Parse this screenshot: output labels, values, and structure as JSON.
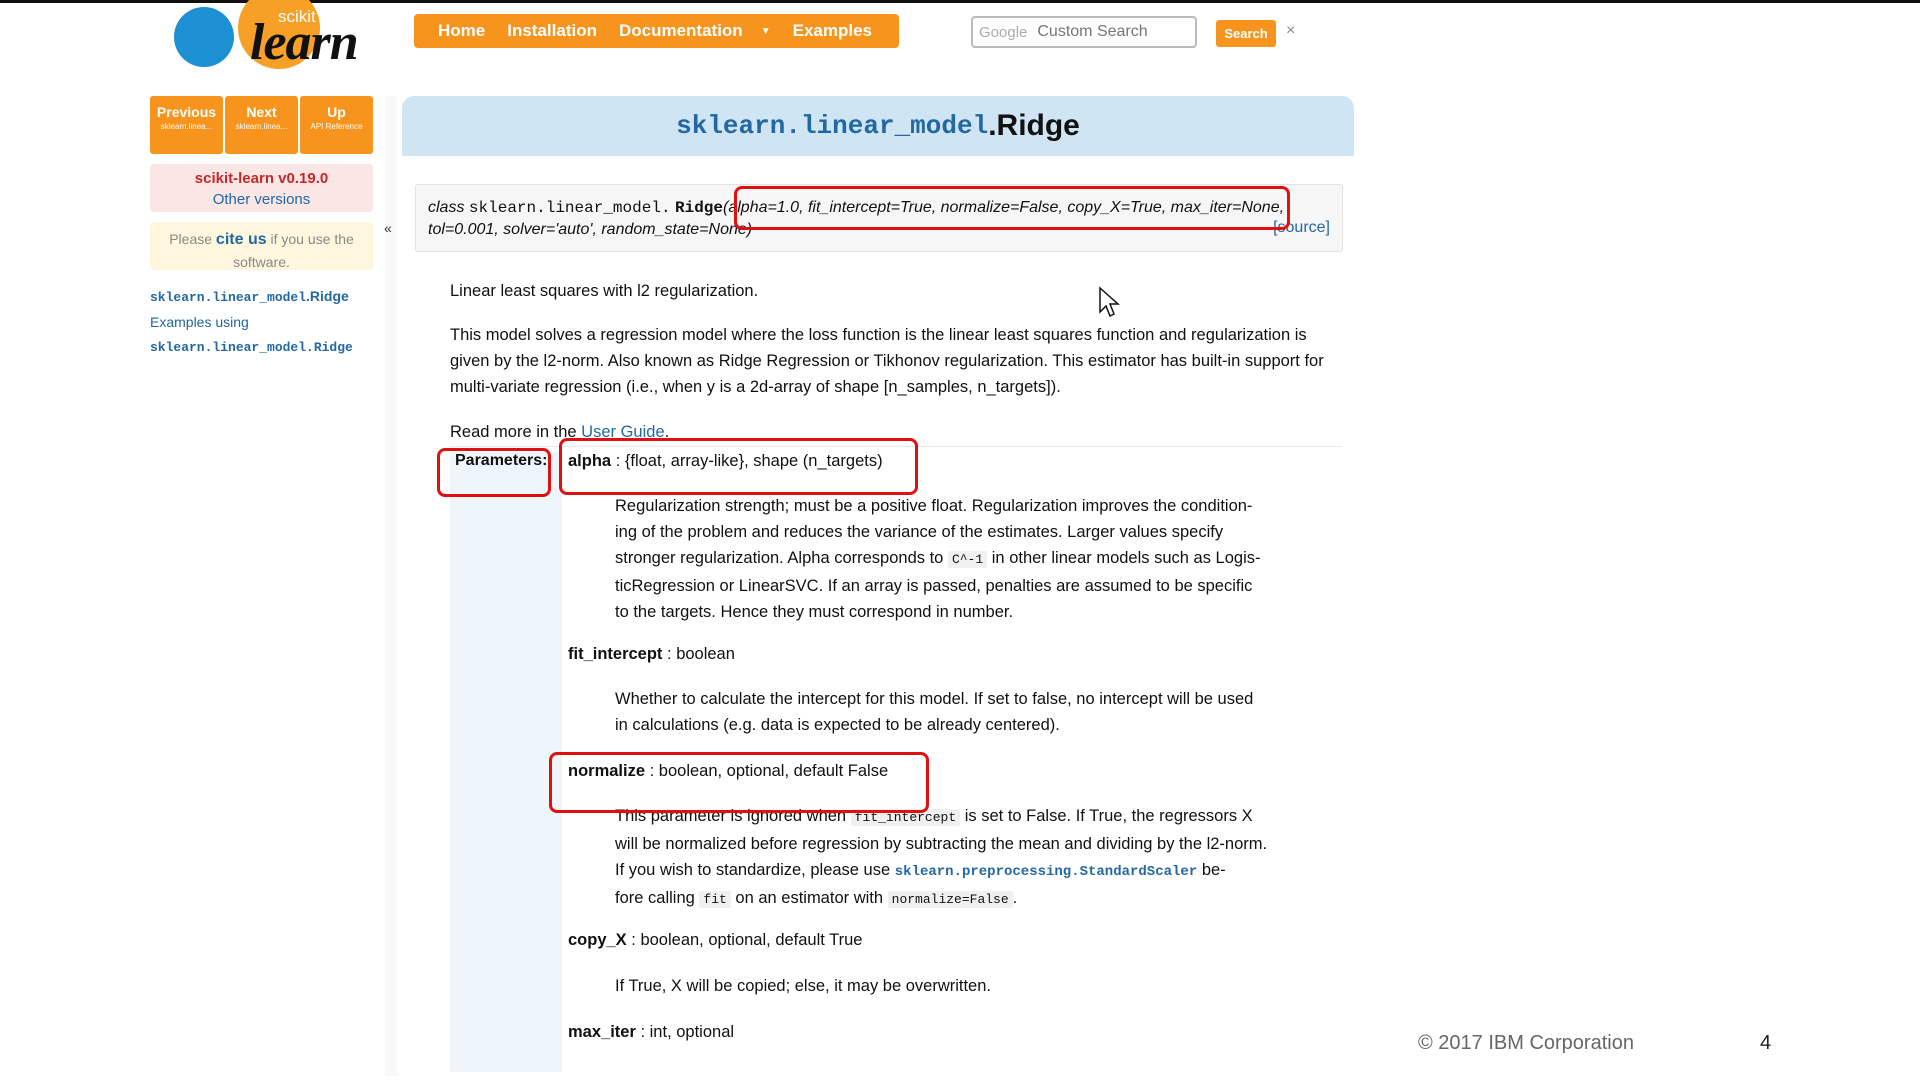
{
  "logo": {
    "scikit": "scikit",
    "learn": "learn"
  },
  "nav": {
    "home": "Home",
    "installation": "Installation",
    "documentation": "Documentation",
    "examples": "Examples"
  },
  "search": {
    "google": "Google",
    "placeholder": "Custom Search",
    "button": "Search",
    "close": "×"
  },
  "sidebar": {
    "previous": {
      "label": "Previous",
      "sub": "sklearn.linea..."
    },
    "next": {
      "label": "Next",
      "sub": "sklearn.linea..."
    },
    "up": {
      "label": "Up",
      "sub": "API Reference"
    },
    "version": "scikit-learn v0.19.0",
    "other_versions": "Other versions",
    "cite_pre": "Please",
    "cite_link": "cite us",
    "cite_post": "if you use the software.",
    "link_module": "sklearn.linear_model",
    "link_class": ".Ridge",
    "examples_using": "Examples using",
    "examples_code": "sklearn.linear_model.Ridge",
    "collapse": "«"
  },
  "title": {
    "module": "sklearn.linear_model",
    "cls": ".Ridge"
  },
  "signature": {
    "prefix": "class",
    "module": "sklearn.linear_model.",
    "cls": "Ridge",
    "args_line1": "(alpha=1.0, fit_intercept=True, normalize=False, copy_X=True, max_iter=None,",
    "args_line2": "tol=0.001, solver='auto', random_state=None)",
    "source": "[source]"
  },
  "intro": "Linear least squares with l2 regularization.",
  "description": "This model solves a regression model where the loss function is the linear least squares function and regularization is given by the l2-norm. Also known as Ridge Regression or Tikhonov regularization. This estimator has built-in support for multi-variate regression (i.e., when y is a 2d-array of shape [n_samples, n_targets]).",
  "read_more": {
    "pre": "Read more in the",
    "link": "User Guide",
    "post": "."
  },
  "params": {
    "label": "Parameters:",
    "alpha": {
      "name": "alpha",
      "type": " : {float, array-like}, shape (n_targets)",
      "d1": "Regularization strength; must be a positive float. Regularization improves the condition-",
      "d2": "ing of the problem and reduces the variance of the estimates. Larger values specify",
      "d3a": "stronger regularization. Alpha corresponds to",
      "d3code": "C^-1",
      "d3b": "in other linear models such as Logis-",
      "d4": "ticRegression or LinearSVC. If an array is passed, penalties are assumed to be specific",
      "d5": "to the targets. Hence they must correspond in number."
    },
    "fit_intercept": {
      "name": "fit_intercept",
      "type": " : boolean",
      "d1": "Whether to calculate the intercept for this model. If set to false, no intercept will be used",
      "d2": "in calculations (e.g. data is expected to be already centered)."
    },
    "normalize": {
      "name": "normalize",
      "type": " : boolean, optional, default False",
      "d1a": "This parameter is ignored when",
      "d1code": "fit_intercept",
      "d1b": "is set to False. If True, the regressors X",
      "d2": "will be normalized before regression by subtracting the mean and dividing by the l2-norm.",
      "d3a": "If you wish to standardize, please use",
      "d3code": "sklearn.preprocessing.StandardScaler",
      "d3b": "be-",
      "d4a": "fore calling",
      "d4code": "fit",
      "d4b": "on an estimator with",
      "d4code2": "normalize=False",
      "d4c": "."
    },
    "copy_X": {
      "name": "copy_X",
      "type": " : boolean, optional, default True",
      "d1": "If True, X will be copied; else, it may be overwritten."
    },
    "max_iter": {
      "name": "max_iter",
      "type": " : int, optional"
    }
  },
  "footer": {
    "copyright": "© 2017 IBM Corporation",
    "page": "4"
  },
  "colors": {
    "accent": "#f7941e",
    "link": "#2368a2",
    "annotation": "#e01010",
    "title_band": "#cfe5f3"
  }
}
